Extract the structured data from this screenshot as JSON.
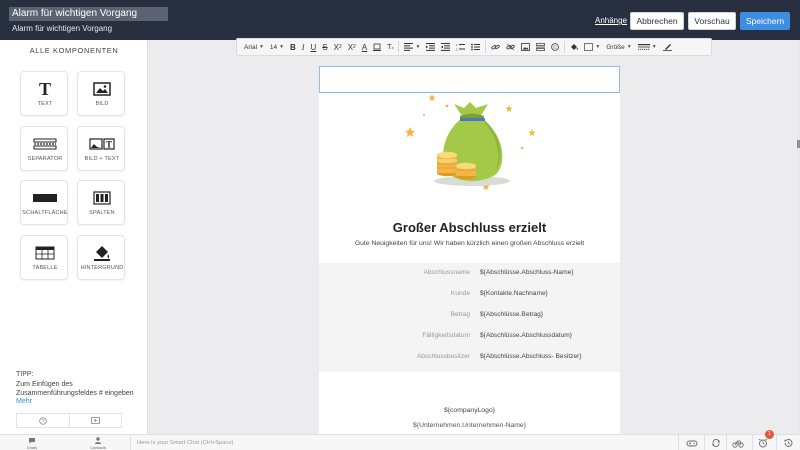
{
  "header": {
    "title_value": "Alarm für wichtigen Vorgang",
    "subtitle": "Alarm für wichtigen Vorgang",
    "attachments_label": "Anhänge",
    "cancel_label": "Abbrechen",
    "preview_label": "Vorschau",
    "save_label": "Speichern"
  },
  "sidebar": {
    "title": "ALLE KOMPONENTEN",
    "components": [
      {
        "label": "TEXT",
        "icon": "text-icon"
      },
      {
        "label": "BILD",
        "icon": "image-icon"
      },
      {
        "label": "SEPARATOR",
        "icon": "separator-icon"
      },
      {
        "label": "BILD + TEXT",
        "icon": "image-text-icon"
      },
      {
        "label": "SCHALTFLÄCHE",
        "icon": "button-icon"
      },
      {
        "label": "SPALTEN",
        "icon": "columns-icon"
      },
      {
        "label": "TABELLE",
        "icon": "table-icon"
      },
      {
        "label": "HINTERGRUND",
        "icon": "paint-bucket-icon"
      }
    ],
    "tip_heading": "TIPP:",
    "tip_text": "Zum Einfügen des Zusammenführungsfeldes # eingeben",
    "tip_more": "Mehr"
  },
  "toolbar": {
    "font_family": "Arial",
    "font_size": "14",
    "size_label": "Größe"
  },
  "email": {
    "heading": "Großer Abschluss erzielt",
    "subline": "Gute Neuigkeiten für uns! Wir haben kürzlich einen großen Abschluss erzielt",
    "details": [
      {
        "label": "Abschlussname",
        "value": "${Abschlüsse.Abschluss-Name}"
      },
      {
        "label": "Kunde",
        "value": "${Kontakte.Nachname}"
      },
      {
        "label": "Betrag",
        "value": "${Abschlüsse.Betrag}"
      },
      {
        "label": "Fälligkeitsdatum",
        "value": "${Abschlüsse.Abschlussdatum}"
      },
      {
        "label": "Abschlussbesitzer",
        "value": "${Abschlüsse.Abschluss- Besitzer}"
      }
    ],
    "footer_logo": "${companyLogo}",
    "footer_company": "${Unternehmen.Unternehmen-Name}"
  },
  "bottombar": {
    "chats_label": "Chats",
    "contacts_label": "Contacts",
    "smart_chat_placeholder": "Here is your Smart Chat (Ctrl+Space)",
    "notification_count": "1"
  },
  "colors": {
    "header_bg": "#283040",
    "accent": "#3d8de0",
    "badge": "#e8533c"
  }
}
